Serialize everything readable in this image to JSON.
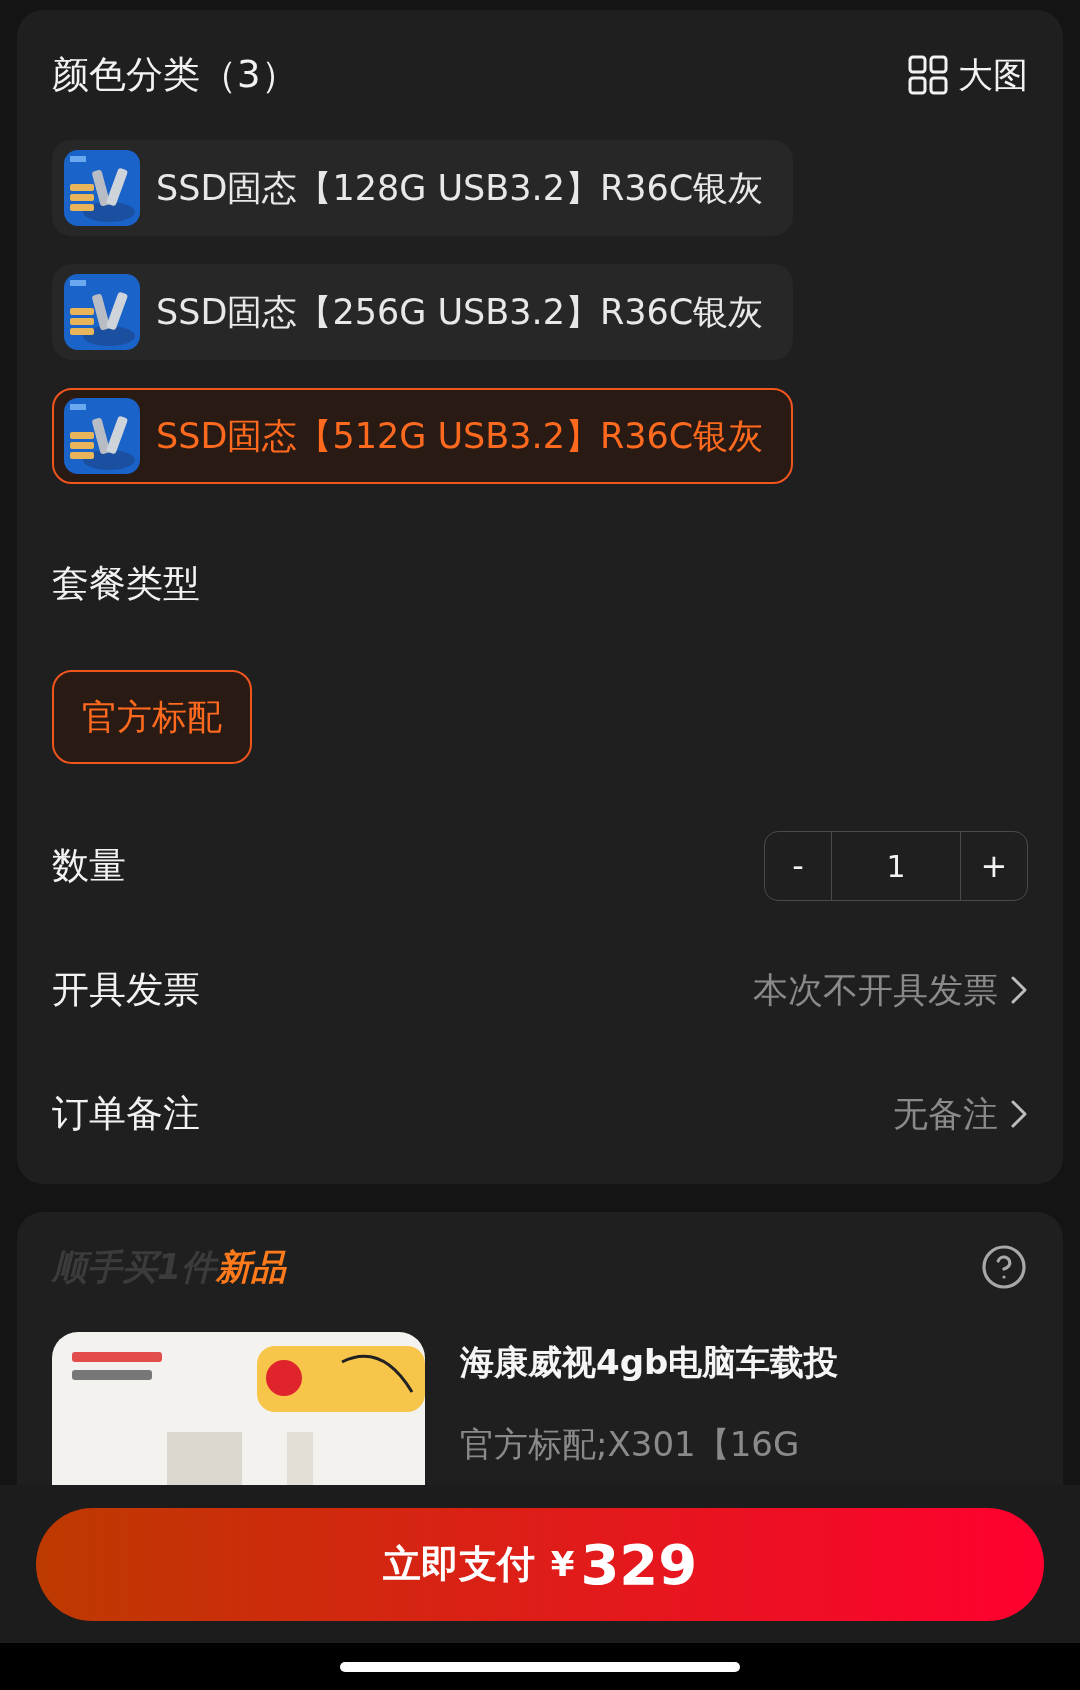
{
  "variant_section": {
    "title": "颜色分类（3）",
    "view_toggle": "大图",
    "options": [
      {
        "label": "SSD固态【128G USB3.2】R36C银灰",
        "selected": false
      },
      {
        "label": "SSD固态【256G USB3.2】R36C银灰",
        "selected": false
      },
      {
        "label": "SSD固态【512G USB3.2】R36C银灰",
        "selected": true
      }
    ]
  },
  "package_section": {
    "title": "套餐类型",
    "options": [
      {
        "label": "官方标配",
        "selected": true
      }
    ]
  },
  "quantity": {
    "label": "数量",
    "minus": "-",
    "value": "1",
    "plus": "+"
  },
  "invoice": {
    "label": "开具发票",
    "value": "本次不开具发票"
  },
  "note": {
    "label": "订单备注",
    "value": "无备注"
  },
  "addon": {
    "title_muted": "顺手买1件",
    "title_highlight": "新品",
    "product": {
      "title": "海康威视4gb电脑车载投",
      "subtitle": "官方标配;X301【16G"
    }
  },
  "pay_button": {
    "label": "立即支付",
    "currency": "¥",
    "amount": "329"
  }
}
